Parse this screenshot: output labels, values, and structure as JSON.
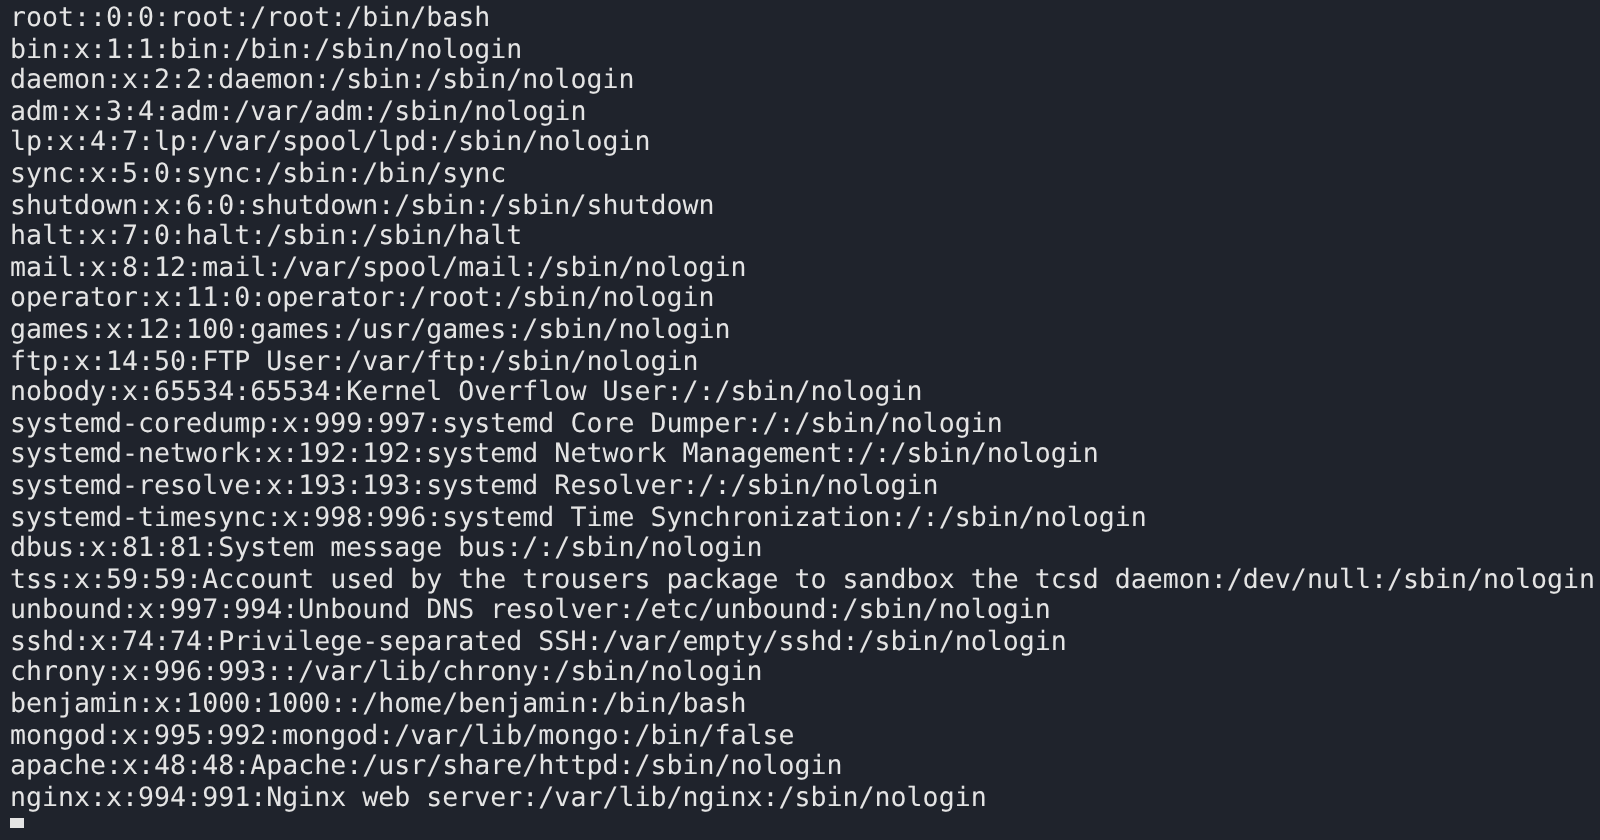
{
  "terminal": {
    "lines": [
      "root::0:0:root:/root:/bin/bash",
      "bin:x:1:1:bin:/bin:/sbin/nologin",
      "daemon:x:2:2:daemon:/sbin:/sbin/nologin",
      "adm:x:3:4:adm:/var/adm:/sbin/nologin",
      "lp:x:4:7:lp:/var/spool/lpd:/sbin/nologin",
      "sync:x:5:0:sync:/sbin:/bin/sync",
      "shutdown:x:6:0:shutdown:/sbin:/sbin/shutdown",
      "halt:x:7:0:halt:/sbin:/sbin/halt",
      "mail:x:8:12:mail:/var/spool/mail:/sbin/nologin",
      "operator:x:11:0:operator:/root:/sbin/nologin",
      "games:x:12:100:games:/usr/games:/sbin/nologin",
      "ftp:x:14:50:FTP User:/var/ftp:/sbin/nologin",
      "nobody:x:65534:65534:Kernel Overflow User:/:/sbin/nologin",
      "systemd-coredump:x:999:997:systemd Core Dumper:/:/sbin/nologin",
      "systemd-network:x:192:192:systemd Network Management:/:/sbin/nologin",
      "systemd-resolve:x:193:193:systemd Resolver:/:/sbin/nologin",
      "systemd-timesync:x:998:996:systemd Time Synchronization:/:/sbin/nologin",
      "dbus:x:81:81:System message bus:/:/sbin/nologin",
      "tss:x:59:59:Account used by the trousers package to sandbox the tcsd daemon:/dev/null:/sbin/nologin",
      "unbound:x:997:994:Unbound DNS resolver:/etc/unbound:/sbin/nologin",
      "sshd:x:74:74:Privilege-separated SSH:/var/empty/sshd:/sbin/nologin",
      "chrony:x:996:993::/var/lib/chrony:/sbin/nologin",
      "benjamin:x:1000:1000::/home/benjamin:/bin/bash",
      "mongod:x:995:992:mongod:/var/lib/mongo:/bin/false",
      "apache:x:48:48:Apache:/usr/share/httpd:/sbin/nologin",
      "nginx:x:994:991:Nginx web server:/var/lib/nginx:/sbin/nologin"
    ]
  }
}
